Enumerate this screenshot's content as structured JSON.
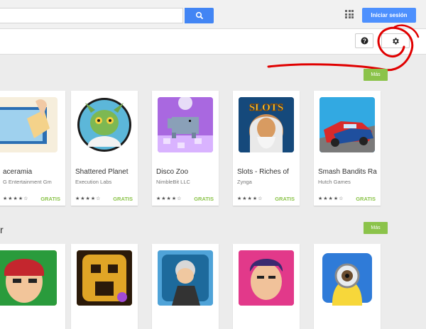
{
  "header": {
    "search_placeholder": "",
    "signin_label": "Iniciar sesión",
    "accent": "#4285f4"
  },
  "toolbar": {
    "help_icon": "help-icon",
    "settings_icon": "gear-icon"
  },
  "sections": [
    {
      "title": "",
      "more_label": "Más",
      "cards": [
        {
          "title": "aceramia",
          "developer": "G Entertainment Gm",
          "price": "GRATIS",
          "rating": 4
        },
        {
          "title": "Shattered Planet",
          "developer": "Execution Labs",
          "price": "GRATIS",
          "rating": 4
        },
        {
          "title": "Disco Zoo",
          "developer": "NimbleBit LLC",
          "price": "GRATIS",
          "rating": 4
        },
        {
          "title": "Slots - Riches of",
          "developer": "Zynga",
          "price": "GRATIS",
          "rating": 4
        },
        {
          "title": "Smash Bandits Ra",
          "developer": "Hutch Games",
          "price": "GRATIS",
          "rating": 4
        }
      ]
    },
    {
      "title": "r",
      "more_label": "Más",
      "cards": []
    }
  ],
  "annotation": {
    "color": "#e00000"
  },
  "slots_text": "SLOTS"
}
